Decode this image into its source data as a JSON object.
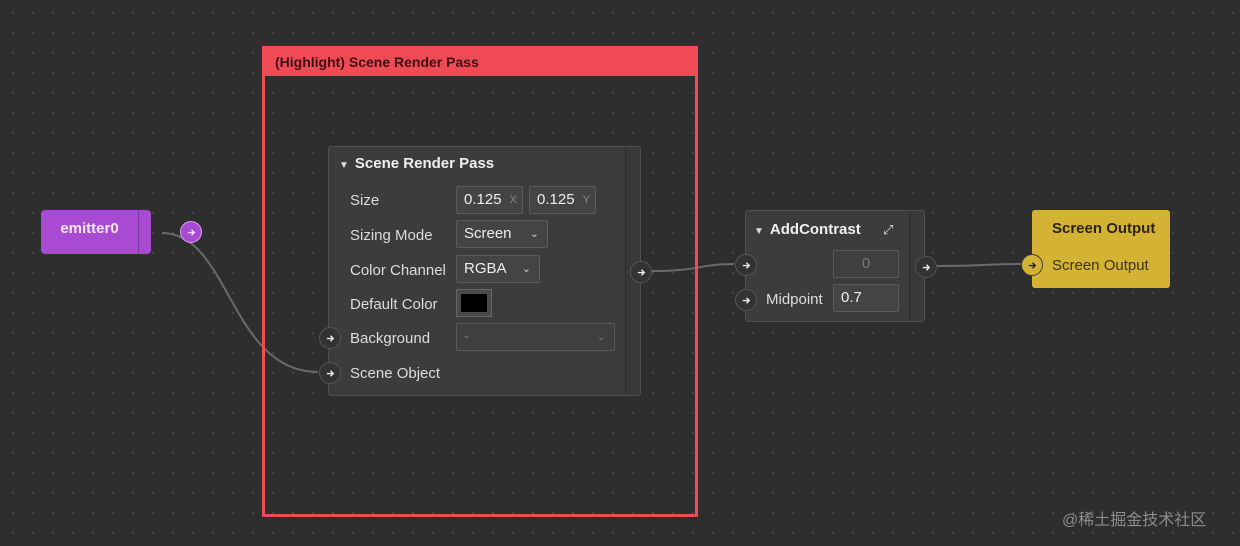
{
  "emitter": {
    "title": "emitter0"
  },
  "group": {
    "title": "(Highlight) Scene Render Pass"
  },
  "scene_render_pass": {
    "title": "Scene Render Pass",
    "size_label": "Size",
    "size_x_value": "0.125",
    "size_x_suffix": "X",
    "size_y_value": "0.125",
    "size_y_suffix": "Y",
    "sizing_mode_label": "Sizing Mode",
    "sizing_mode_value": "Screen",
    "color_channel_label": "Color Channel",
    "color_channel_value": "RGBA",
    "default_color_label": "Default Color",
    "default_color_value": "#000000",
    "background_label": "Background",
    "background_value": "-",
    "scene_object_label": "Scene Object"
  },
  "add_contrast": {
    "title": "AddContrast",
    "input_value": "0",
    "midpoint_label": "Midpoint",
    "midpoint_value": "0.7"
  },
  "screen_output": {
    "title": "Screen Output",
    "input_label": "Screen Output"
  },
  "watermark": "@稀土掘金技术社区",
  "colors": {
    "canvas": "#2e2e2e",
    "emitter": "#a94bd2",
    "highlight": "#f04a55",
    "output": "#d4b234",
    "node": "#3c3c3c"
  }
}
